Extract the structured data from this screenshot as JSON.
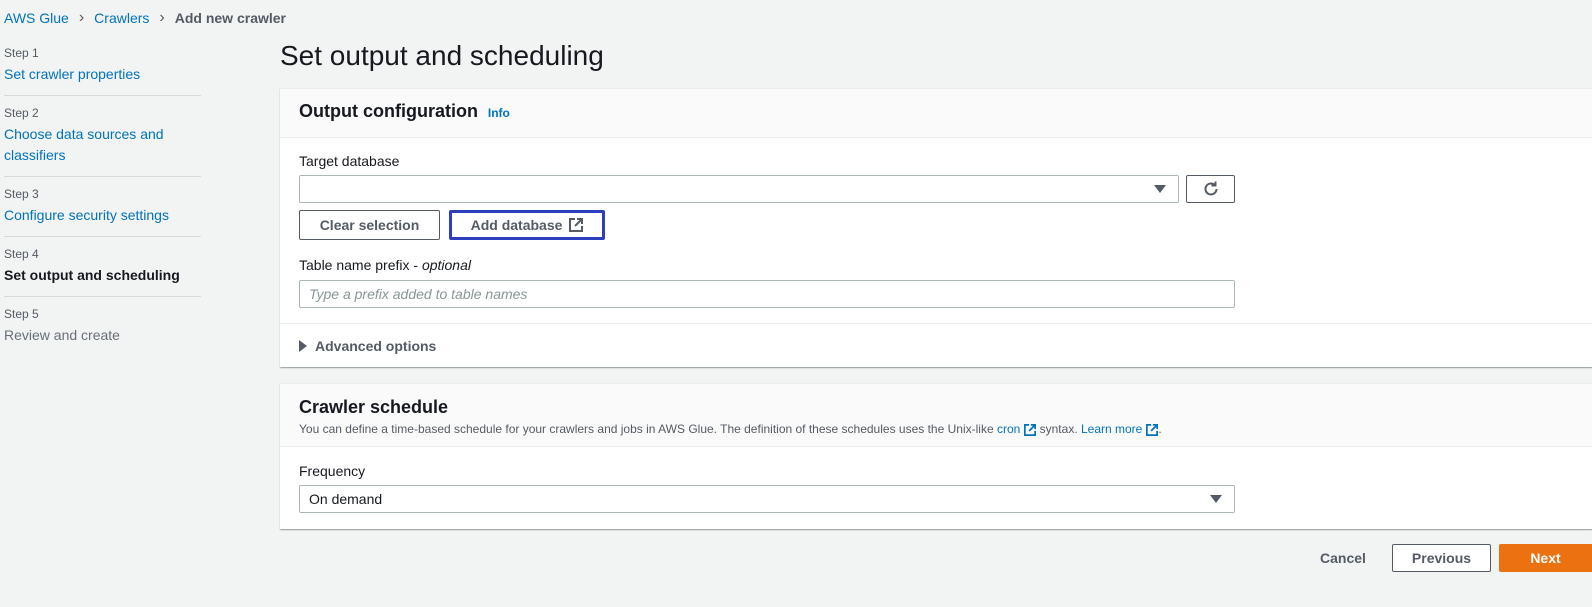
{
  "breadcrumb": {
    "items": [
      "AWS Glue",
      "Crawlers"
    ],
    "current": "Add new crawler"
  },
  "steps": [
    {
      "num": "Step 1",
      "label": "Set crawler properties"
    },
    {
      "num": "Step 2",
      "label": "Choose data sources and classifiers"
    },
    {
      "num": "Step 3",
      "label": "Configure security settings"
    },
    {
      "num": "Step 4",
      "label": "Set output and scheduling"
    },
    {
      "num": "Step 5",
      "label": "Review and create"
    }
  ],
  "page_title": "Set output and scheduling",
  "output_config": {
    "title": "Output configuration",
    "info": "Info",
    "target_db_label": "Target database",
    "target_db_value": "",
    "clear_selection": "Clear selection",
    "add_database": "Add database",
    "prefix_label": "Table name prefix - ",
    "prefix_optional": "optional",
    "prefix_placeholder": "Type a prefix added to table names",
    "advanced_options": "Advanced options"
  },
  "schedule": {
    "title": "Crawler schedule",
    "desc_before": "You can define a time-based schedule for your crawlers and jobs in AWS Glue. The definition of these schedules uses the Unix-like ",
    "cron_link": "cron",
    "desc_middle": " syntax. ",
    "learn_more": "Learn more",
    "desc_end": ".",
    "frequency_label": "Frequency",
    "frequency_value": "On demand"
  },
  "footer": {
    "cancel": "Cancel",
    "previous": "Previous",
    "next": "Next"
  },
  "colors": {
    "link": "#0073bb",
    "primary": "#ec7211",
    "highlight": "#2b3fbf"
  }
}
